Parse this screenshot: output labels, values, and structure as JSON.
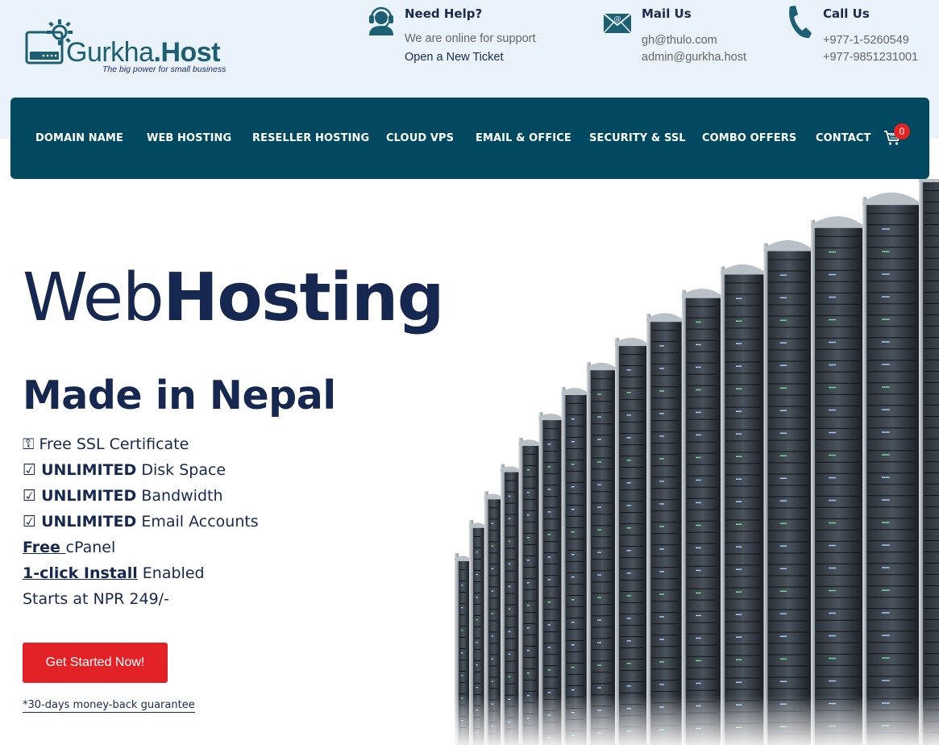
{
  "logo": {
    "brand_part1": "Gurkha",
    "brand_dot": ".",
    "brand_part2": "Host",
    "tagline": "The big power for small business",
    "icon": "server-gear-icon"
  },
  "contacts": [
    {
      "title": "Need Help?",
      "line1": "We are online for support",
      "line2": "Open a New Ticket",
      "icon": "support-agent-icon"
    },
    {
      "title": "Mail Us",
      "line1": "gh@thulo.com",
      "line2": "admin@gurkha.host",
      "icon": "mail-icon"
    },
    {
      "title": "Call Us",
      "line1": "+977-1-5260549",
      "line2": "+977-9851231001",
      "icon": "phone-icon"
    }
  ],
  "nav": {
    "items": [
      "DOMAIN NAME",
      "WEB HOSTING",
      "RESELLER HOSTING",
      "CLOUD VPS",
      "EMAIL & OFFICE",
      "SECURITY & SSL",
      "COMBO OFFERS",
      "CONTACT"
    ],
    "cart_count": "0",
    "cart_icon": "cart-icon"
  },
  "hero": {
    "title_light": "Web",
    "title_bold": "Hosting",
    "subtitle": "Made in Nepal",
    "features": {
      "f1_icon": "⚿",
      "f1_text": "Free SSL Certificate",
      "f2_icon": "☑",
      "f2_bold": "UNLIMITED",
      "f2_text": "Disk Space",
      "f3_icon": "☑",
      "f3_bold": "UNLIMITED",
      "f3_text": "Bandwidth",
      "f4_icon": "☑",
      "f4_bold": "UNLIMITED",
      "f4_text": "Email Accounts",
      "f5_link": "Free ",
      "f5_text": "cPanel",
      "f6_link": "1-click Install",
      "f6_text": "Enabled",
      "f7_text": "Starts at NPR 249/-"
    },
    "cta_label": "Get Started Now!",
    "guarantee": "*30-days money-back guarantee",
    "image": "server-racks-image"
  },
  "colors": {
    "nav_bg": "#004960",
    "top_bg": "#eaf2fb",
    "heading": "#16284f",
    "cta": "#e22227",
    "badge": "#e52320"
  }
}
